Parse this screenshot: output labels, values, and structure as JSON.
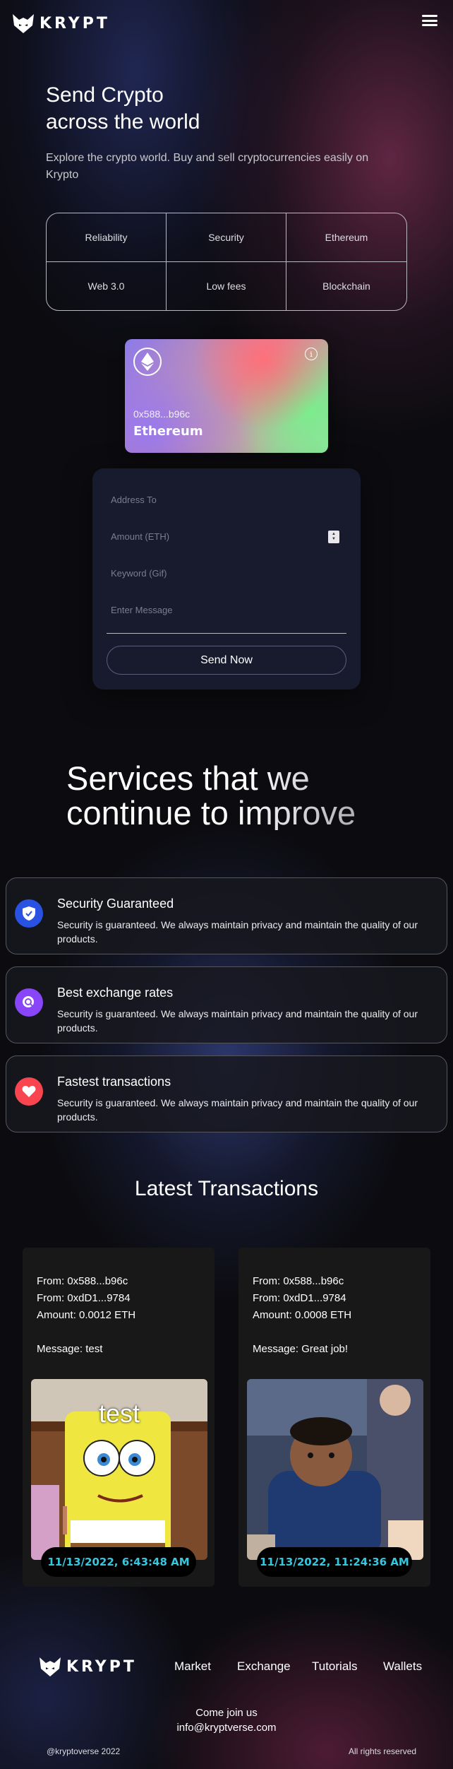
{
  "header": {
    "logo_text": "KRYPT",
    "menu_icon": "hamburger-menu-icon"
  },
  "hero": {
    "title_line1": "Send Crypto",
    "title_line2": "across the world",
    "subtitle": "Explore the crypto world. Buy and sell cryptocurrencies easily on Krypto",
    "features": [
      "Reliability",
      "Security",
      "Ethereum",
      "Web 3.0",
      "Low fees",
      "Blockchain"
    ]
  },
  "eth_card": {
    "address": "0x588...b96c",
    "network": "Ethereum",
    "logo_icon": "ethereum-icon",
    "info_icon": "info-icon"
  },
  "form": {
    "address_placeholder": "Address To",
    "amount_placeholder": "Amount (ETH)",
    "keyword_placeholder": "Keyword (Gif)",
    "message_placeholder": "Enter Message",
    "send_label": "Send Now"
  },
  "services": {
    "title_line1": "Services that we",
    "title_line2": "continue to improve",
    "items": [
      {
        "title": "Security Guaranteed",
        "description": "Security is guaranteed. We always maintain privacy and maintain the quality of our products.",
        "icon": "shield-check-icon",
        "color": "#2952e3"
      },
      {
        "title": "Best exchange rates",
        "description": "Security is guaranteed. We always maintain privacy and maintain the quality of our products.",
        "icon": "search-icon",
        "color": "#8945f8"
      },
      {
        "title": "Fastest transactions",
        "description": "Security is guaranteed. We always maintain privacy and maintain the quality of our products.",
        "icon": "heart-icon",
        "color": "#f84550"
      }
    ]
  },
  "transactions": {
    "title": "Latest Transactions",
    "items": [
      {
        "from": "From: 0x588...b96c",
        "to": "From: 0xdD1...9784",
        "amount": "Amount: 0.0012 ETH",
        "message": "Message: test",
        "gif_caption": "test",
        "timestamp": "11/13/2022, 6:43:48 AM"
      },
      {
        "from": "From: 0x588...b96c",
        "to": "From: 0xdD1...9784",
        "amount": "Amount: 0.0008 ETH",
        "message": "Message: Great job!",
        "gif_caption": "",
        "timestamp": "11/13/2022, 11:24:36 AM"
      }
    ]
  },
  "footer": {
    "logo_text": "KRYPT",
    "nav": [
      "Market",
      "Exchange",
      "Tutorials",
      "Wallets"
    ],
    "join_text": "Come join us",
    "email": "info@kryptverse.com",
    "handle": "@kryptoverse 2022",
    "rights": "All rights reserved"
  },
  "colors": {
    "background": "#0c0c10",
    "form_background": "#181a2e",
    "timestamp": "#36c6e0",
    "card_background": "#181818"
  }
}
